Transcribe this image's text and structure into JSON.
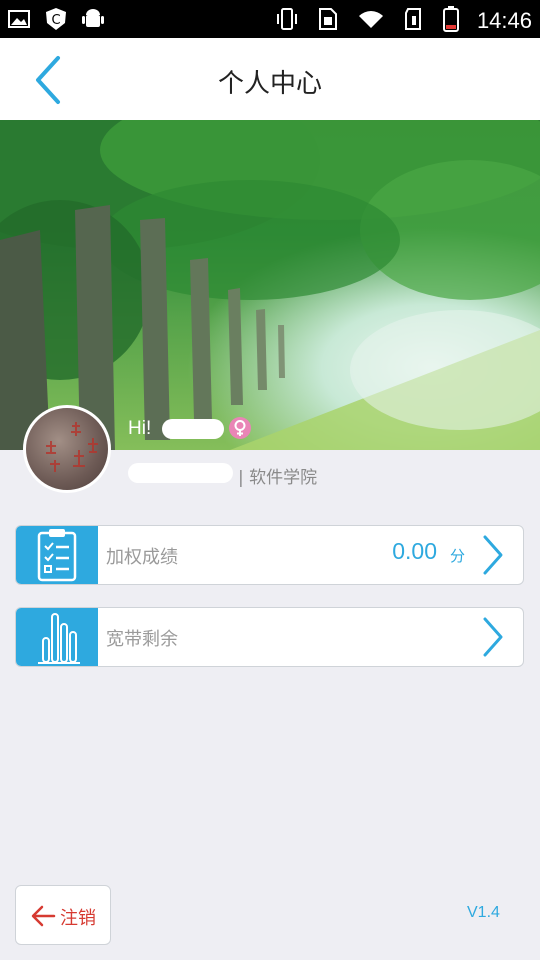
{
  "status_bar": {
    "time": "14:46"
  },
  "header": {
    "title": "个人中心"
  },
  "profile": {
    "greeting": "Hi!",
    "department": "| 软件学院"
  },
  "menu": [
    {
      "label": "加权成绩",
      "value": "0.00",
      "unit": "分"
    },
    {
      "label": "宽带剩余"
    }
  ],
  "footer": {
    "logout_label": "注销",
    "version": "V1.4"
  },
  "colors": {
    "accent": "#2ea9df",
    "logout": "#d63a31",
    "background": "#eeeef3"
  }
}
